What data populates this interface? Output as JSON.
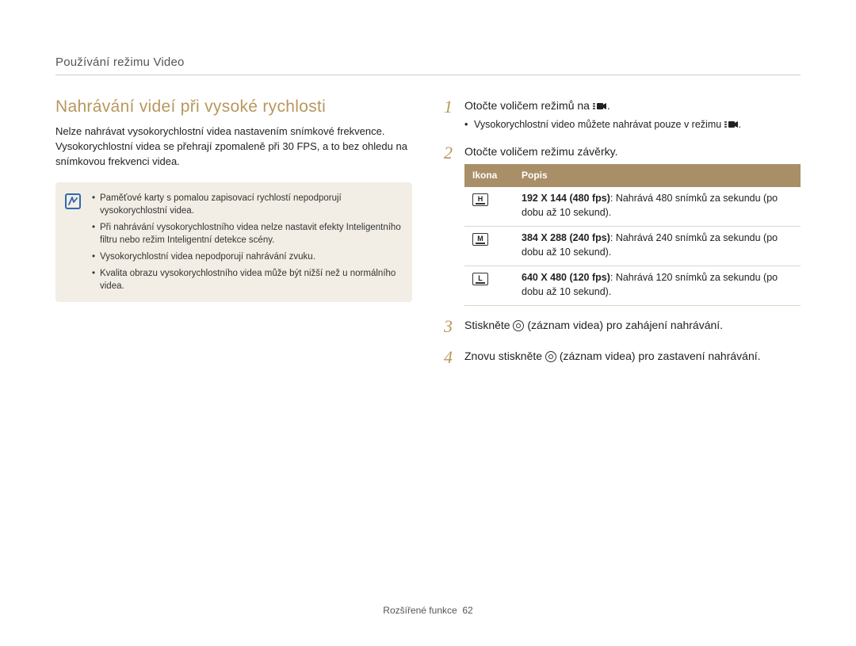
{
  "header": "Používání režimu Video",
  "title": "Nahrávání videí při vysoké rychlosti",
  "intro": "Nelze nahrávat vysokorychlostní videa nastavením  snímkové frekvence. Vysokorychlostní videa se přehrají zpomaleně při 30 FPS, a to bez ohledu na snímkovou frekvenci videa.",
  "notes": [
    "Paměťové karty s pomalou zapisovací rychlostí  nepodporují vysokorychlostní videa.",
    "Při nahrávání vysokorychlostního videa nelze nastavit efekty Inteligentního filtru nebo režim Inteligentní detekce scény.",
    "Vysokorychlostní videa nepodporují nahrávání zvuku.",
    "Kvalita obrazu vysokorychlostního videa může být nižší než u normálního videa."
  ],
  "steps": {
    "s1": {
      "num": "1",
      "pre": "Otočte voličem režimů na ",
      "post": ".",
      "sub_pre": "Vysokorychlostní video můžete nahrávat pouze v režimu ",
      "sub_post": "."
    },
    "s2": {
      "num": "2",
      "text": "Otočte voličem režimu závěrky."
    },
    "s3": {
      "num": "3",
      "pre": "Stiskněte ",
      "mid": " (záznam videa) pro zahájení nahrávání."
    },
    "s4": {
      "num": "4",
      "pre": "Znovu stiskněte ",
      "mid": " (záznam videa) pro zastavení nahrávání."
    }
  },
  "table": {
    "head_icon": "Ikona",
    "head_desc": "Popis",
    "rows": [
      {
        "letter": "H",
        "bold": "192 X 144 (480 fps)",
        "rest": ": Nahrává 480 snímků za sekundu (po dobu až 10 sekund)."
      },
      {
        "letter": "M",
        "bold": "384 X 288 (240 fps)",
        "rest": ": Nahrává 240 snímků za sekundu (po dobu až 10 sekund)."
      },
      {
        "letter": "L",
        "bold": "640 X 480 (120 fps)",
        "rest": ": Nahrává 120 snímků za sekundu (po dobu až 10 sekund)."
      }
    ]
  },
  "footer": {
    "label": "Rozšířené funkce",
    "page": "62"
  }
}
